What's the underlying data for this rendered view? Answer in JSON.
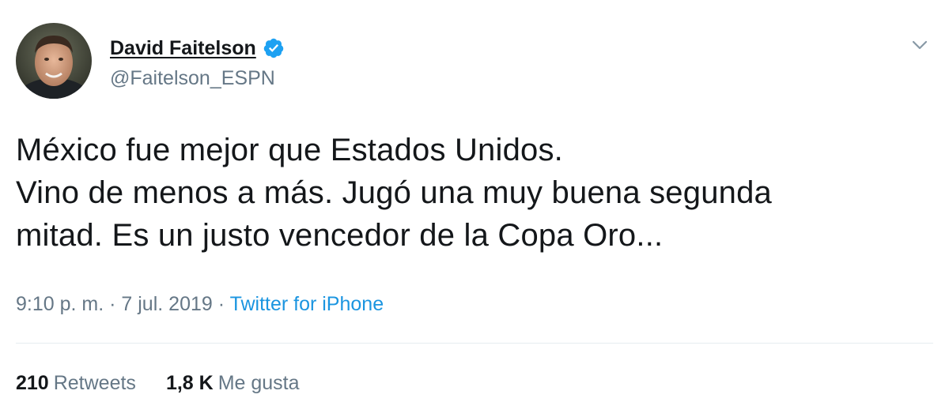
{
  "user": {
    "display_name": "David Faitelson",
    "handle": "@Faitelson_ESPN",
    "verified": true,
    "avatar_icon": "profile-photo"
  },
  "tweet": {
    "lines": [
      "México fue mejor que Estados Unidos.",
      "Vino de menos a más. Jugó una muy buena segunda",
      "mitad. Es un justo vencedor de la Copa Oro..."
    ],
    "time": "9:10 p. m.",
    "date": "7 jul. 2019",
    "separator": "·",
    "source": "Twitter for iPhone"
  },
  "stats": {
    "retweets_count": "210",
    "retweets_label": "Retweets",
    "likes_count": "1,8 K",
    "likes_label": "Me gusta"
  },
  "colors": {
    "text": "#14171a",
    "secondary": "#657786",
    "link": "#1b95e0",
    "verified": "#1da1f2",
    "divider": "#e6ecf0"
  },
  "icons": {
    "verified": "verified-badge-icon",
    "more": "chevron-down-icon"
  }
}
